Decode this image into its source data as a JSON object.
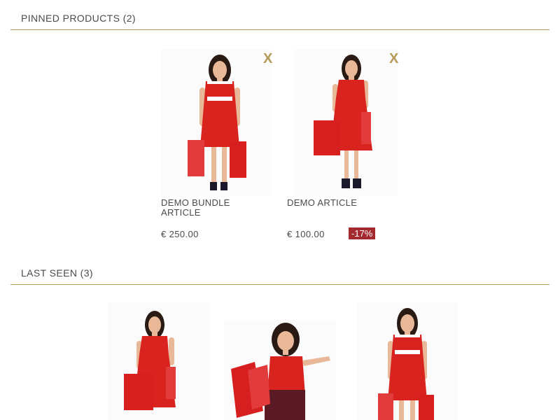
{
  "pinned": {
    "title": "PINNED PRODUCTS (2)",
    "remove_label": "X",
    "products": [
      {
        "name": "DEMO BUNDLE ARTICLE",
        "price": "€ 250.00",
        "discount": ""
      },
      {
        "name": "DEMO ARTICLE",
        "price": "€ 100.00",
        "discount": "-17%"
      }
    ]
  },
  "last_seen": {
    "title": "LAST SEEN (3)"
  },
  "colors": {
    "accent": "#b59a57",
    "discount": "#a3292e",
    "dress": "#d8231f"
  }
}
